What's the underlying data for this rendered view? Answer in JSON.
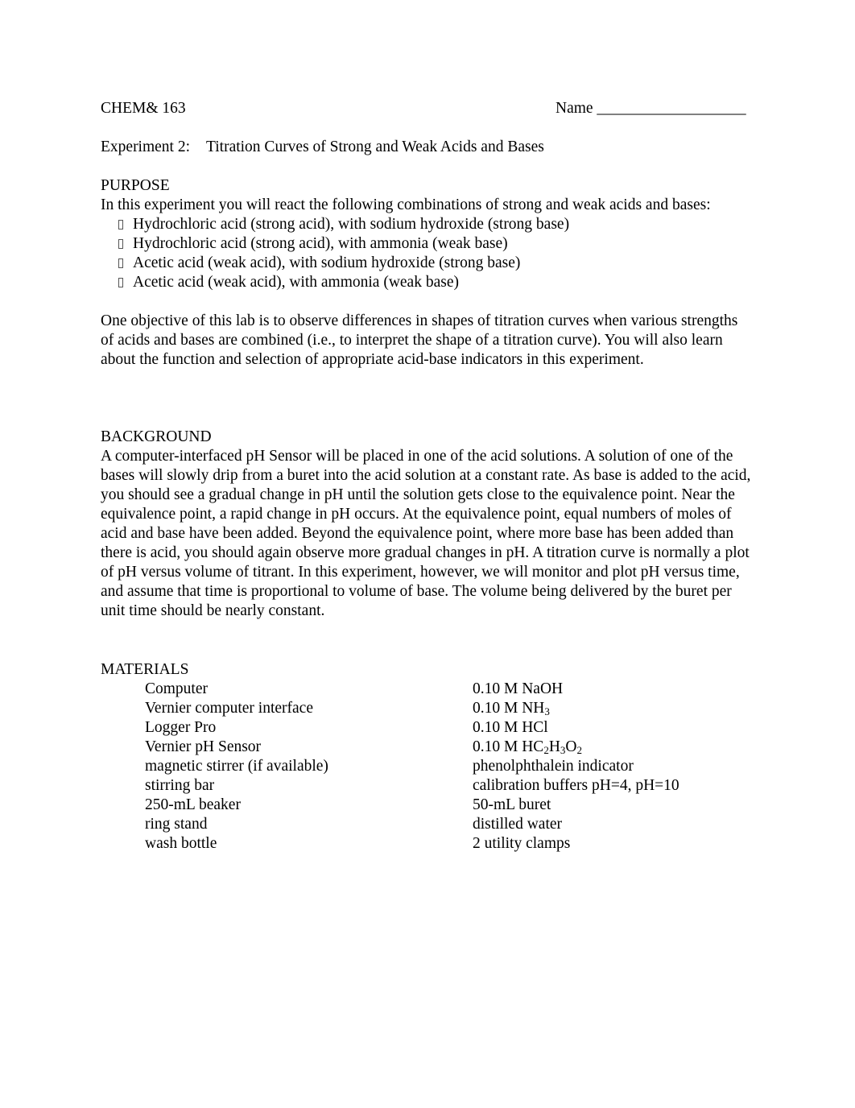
{
  "header": {
    "course": "CHEM& 163",
    "name_label": "Name ___________________"
  },
  "title": {
    "experiment": "Experiment 2:",
    "name": "Titration Curves of Strong and Weak Acids and Bases"
  },
  "purpose": {
    "heading": "PURPOSE",
    "intro": "In this experiment you will react the following combinations of strong and weak acids and bases:",
    "bullet_icon": "missing-glyph-box-icon",
    "items": [
      "Hydrochloric acid (strong acid), with sodium hydroxide (strong base)",
      "Hydrochloric acid (strong acid), with ammonia (weak base)",
      "Acetic acid (weak acid), with sodium hydroxide (strong base)",
      "Acetic acid (weak acid), with ammonia (weak base)"
    ],
    "objective": "One objective of this lab is to observe differences in shapes of titration curves when various strengths of acids and bases are combined (i.e., to interpret the shape of a titration curve). You will also learn about the function and selection of appropriate acid-base indicators in this experiment."
  },
  "background": {
    "heading": "BACKGROUND",
    "text": "A computer-interfaced pH Sensor will be placed in one of the acid solutions. A solution of one of the bases will slowly drip from a buret into the acid solution at a constant rate. As base is added to the acid, you should see a gradual change in pH until the solution gets close to the equivalence point. Near the equivalence point, a rapid change in pH occurs. At the equivalence point, equal numbers of moles of acid and base have been added. Beyond the equivalence point, where more base has been added than there is acid, you should again observe more gradual changes in pH. A titration curve is normally a plot of pH versus volume of titrant. In this experiment, however, we will monitor and plot pH versus time, and assume that time is proportional to volume of base. The volume being delivered by the buret per unit time should be nearly constant."
  },
  "materials": {
    "heading": "MATERIALS",
    "left": [
      "Computer",
      "Vernier computer interface",
      "Logger Pro",
      "Vernier pH Sensor",
      "magnetic stirrer (if available)",
      "stirring bar",
      "250-mL beaker",
      "ring stand",
      "wash bottle"
    ],
    "right": [
      {
        "t": "0.10 M NaOH",
        "s1": "",
        "t2": "",
        "s2": "",
        "t3": "",
        "s3": ""
      },
      {
        "t": "0.10 M NH",
        "s1": "3",
        "t2": "",
        "s2": "",
        "t3": "",
        "s3": ""
      },
      {
        "t": "0.10 M HCl",
        "s1": "",
        "t2": "",
        "s2": "",
        "t3": "",
        "s3": ""
      },
      {
        "t": "0.10 M HC",
        "s1": "2",
        "t2": "H",
        "s2": "3",
        "t3": "O",
        "s3": "2"
      },
      {
        "t": "phenolphthalein indicator",
        "s1": "",
        "t2": "",
        "s2": "",
        "t3": "",
        "s3": ""
      },
      {
        "t": "calibration buffers pH=4, pH=10",
        "s1": "",
        "t2": "",
        "s2": "",
        "t3": "",
        "s3": ""
      },
      {
        "t": "50-mL buret",
        "s1": "",
        "t2": "",
        "s2": "",
        "t3": "",
        "s3": ""
      },
      {
        "t": "distilled water",
        "s1": "",
        "t2": "",
        "s2": "",
        "t3": "",
        "s3": ""
      },
      {
        "t": "2 utility clamps",
        "s1": "",
        "t2": "",
        "s2": "",
        "t3": "",
        "s3": ""
      }
    ]
  }
}
